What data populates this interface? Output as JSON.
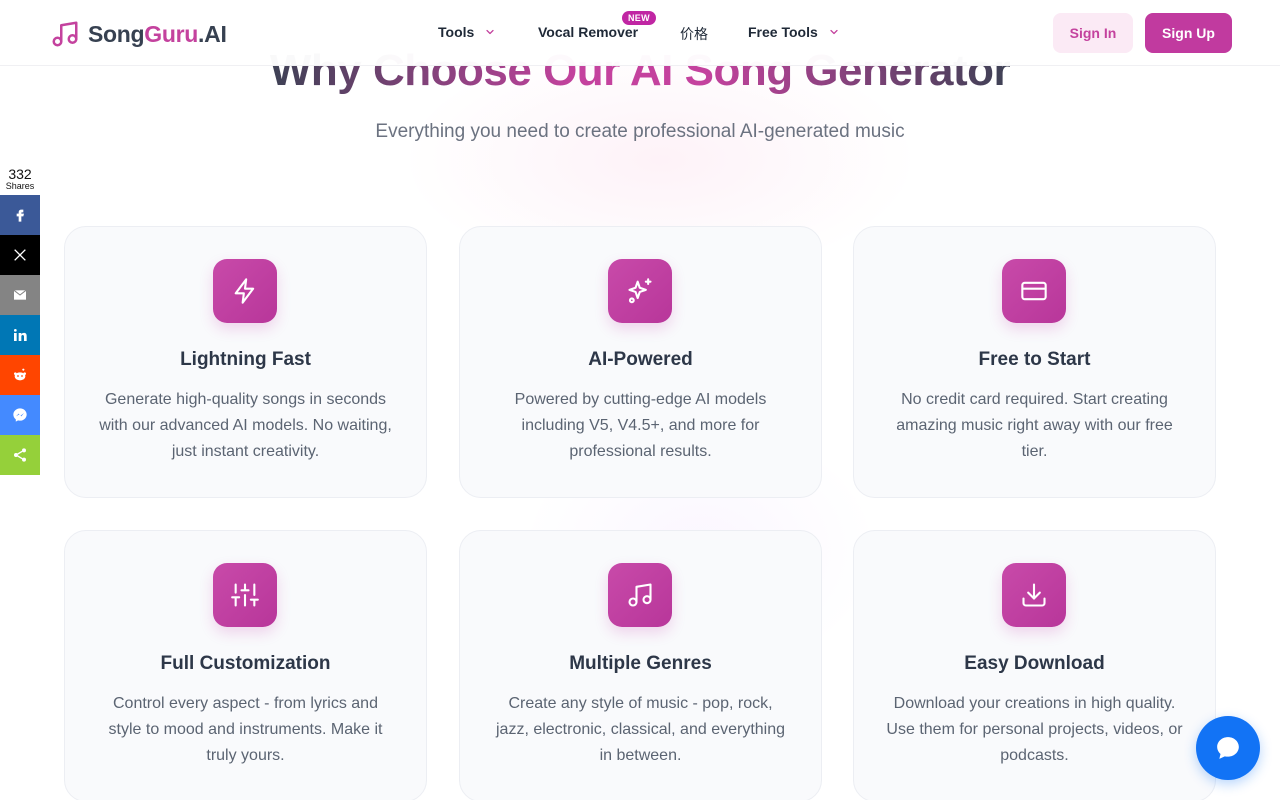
{
  "header": {
    "logo_part1": "Song",
    "logo_part2": "Guru",
    "logo_part3": ".AI",
    "nav": {
      "tools": "Tools",
      "vocal_remover": "Vocal Remover",
      "new_badge": "NEW",
      "pricing": "价格",
      "free_tools": "Free Tools"
    },
    "sign_in": "Sign In",
    "sign_up": "Sign Up"
  },
  "hero": {
    "title": "Why Choose Our AI Song Generator",
    "subtitle": "Everything you need to create professional AI-generated music"
  },
  "share": {
    "count": "332",
    "label": "Shares",
    "buttons": [
      {
        "name": "facebook",
        "icon": "facebook-icon",
        "color": "#3b5998"
      },
      {
        "name": "x",
        "icon": "x-icon",
        "color": "#000000"
      },
      {
        "name": "email",
        "icon": "email-icon",
        "color": "#848484"
      },
      {
        "name": "linkedin",
        "icon": "linkedin-icon",
        "color": "#0077b5"
      },
      {
        "name": "reddit",
        "icon": "reddit-icon",
        "color": "#ff4500"
      },
      {
        "name": "messenger",
        "icon": "messenger-icon",
        "color": "#448aff"
      },
      {
        "name": "sharethis",
        "icon": "share-icon",
        "color": "#95d03a"
      }
    ]
  },
  "features": [
    {
      "icon": "lightning-icon",
      "title": "Lightning Fast",
      "description": "Generate high-quality songs in seconds with our advanced AI models. No waiting, just instant creativity."
    },
    {
      "icon": "sparkles-icon",
      "title": "AI-Powered",
      "description": "Powered by cutting-edge AI models including V5, V4.5+, and more for professional results."
    },
    {
      "icon": "credit-card-icon",
      "title": "Free to Start",
      "description": "No credit card required. Start creating amazing music right away with our free tier."
    },
    {
      "icon": "sliders-icon",
      "title": "Full Customization",
      "description": "Control every aspect - from lyrics and style to mood and instruments. Make it truly yours."
    },
    {
      "icon": "music-note-icon",
      "title": "Multiple Genres",
      "description": "Create any style of music - pop, rock, jazz, electronic, classical, and everything in between."
    },
    {
      "icon": "download-icon",
      "title": "Easy Download",
      "description": "Download your creations in high quality. Use them for personal projects, videos, or podcasts."
    }
  ],
  "colors": {
    "brand": "#c4429e",
    "chat": "#1273f5"
  }
}
